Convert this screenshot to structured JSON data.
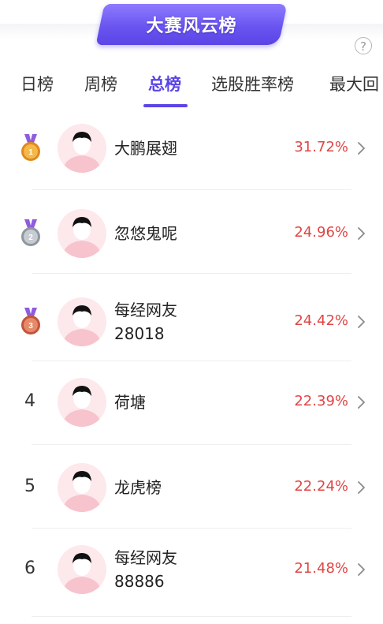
{
  "banner": {
    "title": "大赛风云榜"
  },
  "help": {
    "icon": "question-circle-icon",
    "glyph": "?"
  },
  "tabs": [
    {
      "label": "日榜",
      "active": false
    },
    {
      "label": "周榜",
      "active": false
    },
    {
      "label": "总榜",
      "active": true
    },
    {
      "label": "选股胜率榜",
      "active": false
    },
    {
      "label": "最大回",
      "active": false
    }
  ],
  "colors": {
    "accent": "#5b45e6",
    "positive": "#e04545",
    "gold": "#f0a53a",
    "silver": "#a9b0b8",
    "bronze": "#d46a4c"
  },
  "rankings": [
    {
      "rank": "1",
      "medal": "gold-medal-icon",
      "name_lines": [
        "大鹏展翅"
      ],
      "return": "31.72%"
    },
    {
      "rank": "2",
      "medal": "silver-medal-icon",
      "name_lines": [
        "忽悠鬼呢"
      ],
      "return": "24.96%"
    },
    {
      "rank": "3",
      "medal": "bronze-medal-icon",
      "name_lines": [
        "每经网友",
        "28018"
      ],
      "return": "24.42%"
    },
    {
      "rank": "4",
      "medal": "",
      "name_lines": [
        "荷塘"
      ],
      "return": "22.39%"
    },
    {
      "rank": "5",
      "medal": "",
      "name_lines": [
        "龙虎榜"
      ],
      "return": "22.24%"
    },
    {
      "rank": "6",
      "medal": "",
      "name_lines": [
        "每经网友",
        "88886"
      ],
      "return": "21.48%"
    }
  ]
}
